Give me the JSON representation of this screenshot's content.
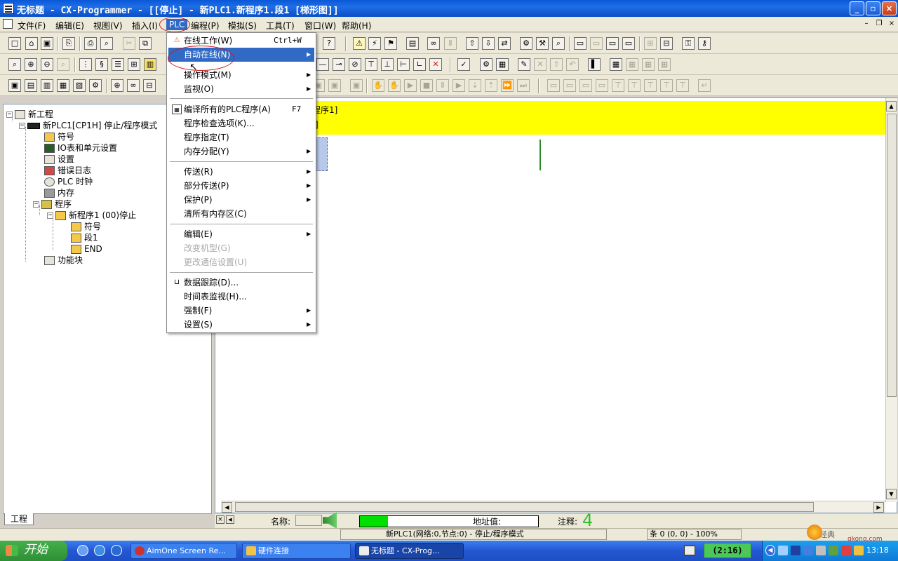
{
  "window": {
    "title": "无标题 - CX-Programmer - [[停止] - 新PLC1.新程序1.段1 [梯形图]]"
  },
  "menubar": {
    "items": [
      "文件(F)",
      "编辑(E)",
      "视图(V)",
      "插入(I)",
      "PLC",
      "编程(P)",
      "模拟(S)",
      "工具(T)",
      "窗口(W)",
      "帮助(H)"
    ],
    "active": "PLC"
  },
  "plc_menu": {
    "items": [
      {
        "label": "在线工作(W)",
        "shortcut": "Ctrl+W",
        "icon": "warning-icon"
      },
      {
        "label": "自动在线(N)",
        "submenu": true,
        "highlighted": true
      },
      {
        "label": "操作模式(M)",
        "submenu": true
      },
      {
        "label": "监视(O)",
        "submenu": true
      },
      {
        "label": "编译所有的PLC程序(A)",
        "shortcut": "F7",
        "icon": "compile-icon"
      },
      {
        "label": "程序检查选项(K)..."
      },
      {
        "label": "程序指定(T)"
      },
      {
        "label": "内存分配(Y)",
        "submenu": true
      },
      {
        "label": "传送(R)",
        "submenu": true
      },
      {
        "label": "部分传送(P)",
        "submenu": true
      },
      {
        "label": "保护(P)",
        "submenu": true
      },
      {
        "label": "清所有内存区(C)"
      },
      {
        "label": "编辑(E)",
        "submenu": true
      },
      {
        "label": "改变机型(G)",
        "disabled": true
      },
      {
        "label": "更改通信设置(U)",
        "disabled": true
      },
      {
        "label": "数据跟踪(D)...",
        "icon": "data-trace-icon"
      },
      {
        "label": "时间表监视(H)..."
      },
      {
        "label": "强制(F)",
        "submenu": true
      },
      {
        "label": "设置(S)",
        "submenu": true
      }
    ]
  },
  "tree": {
    "root": "新工程",
    "plc": "新PLC1[CP1H] 停止/程序模式",
    "plc_children": [
      "符号",
      "IO表和单元设置",
      "设置",
      "错误日志",
      "PLC 时钟",
      "内存"
    ],
    "programs": "程序",
    "program": "新程序1 (00)停止",
    "program_children": [
      "符号",
      "段1",
      "END"
    ],
    "function_blocks": "功能块",
    "tab": "工程"
  },
  "ladder": {
    "header_line1": "程序1]",
    "header_line2": "]"
  },
  "status": {
    "name_label": "名称:",
    "address_label": "地址值:",
    "comment_label": "注释:",
    "comment_value": "4",
    "connection_text": "新PLC1(网络:0,节点:0) - 停止/程序模式",
    "rung_info": "条 0 (0, 0)  - 100%"
  },
  "taskbar": {
    "start": "开始",
    "tasks": [
      "AimOne Screen Re...",
      "硬件连接",
      "无标题 - CX-Prog..."
    ],
    "active_task": "无标题 - CX-Prog...",
    "counter": "(2:16)",
    "clock": "13:18",
    "classic": "经典",
    "watermark_url": "gkong.com"
  }
}
